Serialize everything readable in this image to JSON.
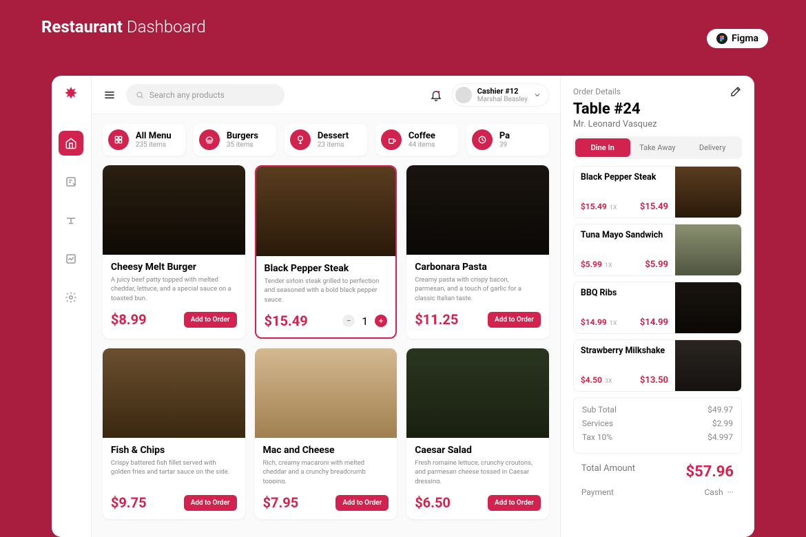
{
  "outerTitle": {
    "bold": "Restaurant",
    "light": "Dashboard"
  },
  "figmaBadge": "Figma",
  "search": {
    "placeholder": "Search any products"
  },
  "user": {
    "role": "Cashier #12",
    "name": "Marshal Beasley"
  },
  "categories": [
    {
      "name": "All Menu",
      "count": "235 items"
    },
    {
      "name": "Burgers",
      "count": "35 items"
    },
    {
      "name": "Dessert",
      "count": "23 items"
    },
    {
      "name": "Coffee",
      "count": "44 items"
    },
    {
      "name": "Pa",
      "count": "39"
    }
  ],
  "products": [
    {
      "title": "Cheesy Melt Burger",
      "desc": "A juicy beef patty topped with melted cheddar, lettuce, and a special sauce on a toasted bun.",
      "price": "$8.99",
      "btn": "Add to Order"
    },
    {
      "title": "Black Pepper Steak",
      "desc": "Tender sirloin steak grilled to perfection and seasoned with a bold black pepper sauce.",
      "price": "$15.49",
      "selected": true,
      "qty": "1"
    },
    {
      "title": "Carbonara Pasta",
      "desc": "Creamy pasta with crispy bacon, parmesan, and a touch of garlic for a classic Italian taste.",
      "price": "$11.25",
      "btn": "Add to Order"
    },
    {
      "title": "Fish & Chips",
      "desc": "Crispy battered fish fillet served with golden fries and tartar sauce on the side.",
      "price": "$9.75",
      "btn": "Add to Order"
    },
    {
      "title": "Mac and Cheese",
      "desc": "Rich, creamy macaroni with melted cheddar and a crunchy breadcrumb topping.",
      "price": "$7.95",
      "btn": "Add to Order"
    },
    {
      "title": "Caesar Salad",
      "desc": "Fresh romaine lettuce, crunchy croutons, and parmesan cheese tossed in Caesar dressing.",
      "price": "$6.50",
      "btn": "Add to Order"
    }
  ],
  "order": {
    "headLabel": "Order Details",
    "table": "Table #24",
    "customer": "Mr. Leonard Vasquez",
    "tabs": [
      "Dine In",
      "Take Away",
      "Delivery"
    ],
    "items": [
      {
        "name": "Black Pepper Steak",
        "unit": "$15.49",
        "qty": "1X",
        "total": "$15.49"
      },
      {
        "name": "Tuna Mayo Sandwich",
        "unit": "$5.99",
        "qty": "1X",
        "total": "$5.99"
      },
      {
        "name": "BBQ Ribs",
        "unit": "$14.99",
        "qty": "1X",
        "total": "$14.99"
      },
      {
        "name": "Strawberry Milkshake",
        "unit": "$4.50",
        "qty": "3X",
        "total": "$13.50"
      }
    ],
    "summary": [
      {
        "label": "Sub Total",
        "value": "$49.97"
      },
      {
        "label": "Services",
        "value": "$2.99"
      },
      {
        "label": "Tax 10%",
        "value": "$4.997"
      }
    ],
    "totalLabel": "Total Amount",
    "totalValue": "$57.96",
    "paymentLabel": "Payment",
    "paymentMethod": "Cash"
  }
}
